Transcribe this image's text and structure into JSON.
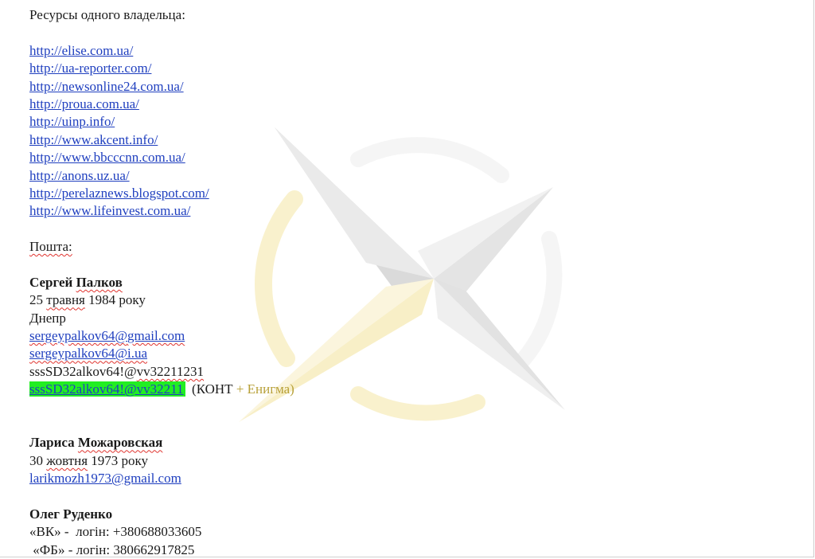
{
  "heading": "Ресурсы одного владельца:",
  "links": [
    "http://elise.com.ua/",
    "http://ua-reporter.com/",
    "http://newsonline24.com.ua/",
    "http://proua.com.ua/",
    "http://uinp.info/",
    "http://www.akcent.info/",
    "http://www.bbcccnn.com.ua/",
    "http://anons.uz.ua/",
    "http://perelaznews.blogspot.com/",
    "http://www.lifeinvest.com.ua/"
  ],
  "mail_label": "Пошта:",
  "person1": {
    "first_name": "Сергей",
    "last_name": "Палков",
    "birth_day": "25",
    "birth_month": "травня",
    "birth_year": "1984 року",
    "city": "Днепр",
    "email1_user": "sergeypalkov64@",
    "email1_domain": "gmail.com",
    "email2_user": "sergeypalkov64@",
    "email2_domain": "i.ua",
    "password_prefix": "sssSD32alkov64!@",
    "password_suffix": "vv32211231",
    "highlighted_password": "sssSD32alkov64!@vv32211",
    "note_open": "(КОНТ",
    "note_plus": "+",
    "note_rest": "Енигма)"
  },
  "person2": {
    "first_name": "Лариса",
    "last_name": "Можаровская",
    "birth_day": "30",
    "birth_month": "жовтня",
    "birth_year": "1973 року",
    "email": "larikmozh1973@gmail.com"
  },
  "person3": {
    "name": "Олег Руденко",
    "vk_line": "«ВК» -  логін: +380688033605",
    "fb_line": " «ФБ» - логін: 380662917825"
  }
}
